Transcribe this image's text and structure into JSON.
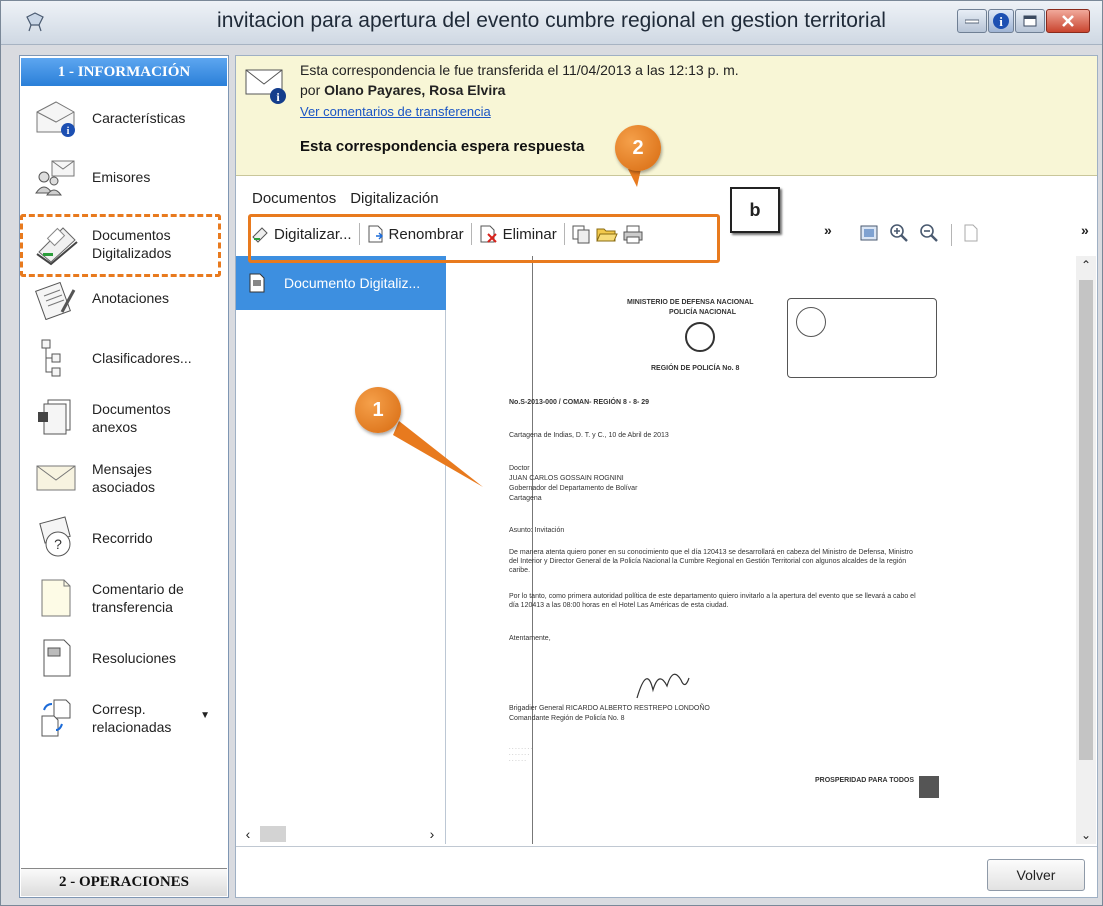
{
  "window": {
    "title": "invitacion para apertura del evento cumbre regional en gestion territorial"
  },
  "sidebar": {
    "header_top": "1 - INFORMACIÓN",
    "header_bottom": "2 - OPERACIONES",
    "items": [
      {
        "label": "Características",
        "icon": "envelope-info-icon"
      },
      {
        "label": "Emisores",
        "icon": "senders-icon"
      },
      {
        "label": "Documentos Digitalizados",
        "icon": "scanner-icon"
      },
      {
        "label": "Anotaciones",
        "icon": "clipboard-icon"
      },
      {
        "label": "Clasificadores...",
        "icon": "tree-icon"
      },
      {
        "label": "Documentos anexos",
        "icon": "attachments-icon"
      },
      {
        "label": "Mensajes asociados",
        "icon": "envelope-icon"
      },
      {
        "label": "Recorrido",
        "icon": "route-icon"
      },
      {
        "label": "Comentario de transferencia",
        "icon": "note-icon"
      },
      {
        "label": "Resoluciones",
        "icon": "resolution-icon"
      },
      {
        "label": "Corresp. relacionadas",
        "icon": "related-icon"
      }
    ]
  },
  "notice": {
    "line1": "Esta correspondencia le fue transferida el 11/04/2013 a las 12:13 p. m.",
    "by_prefix": "por ",
    "by_name": "Olano Payares, Rosa Elvira",
    "link": "Ver comentarios de transferencia",
    "await": "Esta correspondencia espera respuesta"
  },
  "menu": {
    "documentos": "Documentos",
    "digitalizacion": "Digitalización"
  },
  "toolbar": {
    "digitalizar": "Digitalizar...",
    "renombrar": "Renombrar",
    "eliminar": "Eliminar",
    "overflow": "»"
  },
  "document_list": {
    "items": [
      "Documento Digitaliz..."
    ]
  },
  "scan": {
    "header1": "MINISTERIO DE DEFENSA NACIONAL",
    "header2": "POLICÍA NACIONAL",
    "header3": "REGIÓN DE POLICÍA No. 8",
    "ref": "No.S-2013-000        / COMAN- REGIÓN 8 - 8- 29",
    "city": "Cartagena de Indias, D. T. y C., 10 de Abril de 2013",
    "doctor": "Doctor",
    "name": "JUAN CARLOS GOSSAIN ROGNINI",
    "role": "Gobernador del Departamento de Bolívar",
    "place": "Cartagena",
    "subject": "Asunto: Invitación",
    "p1": "De manera atenta quiero poner en su conocimiento que el día 120413 se desarrollará en cabeza del Ministro de Defensa, Ministro del Interior y Director General de la Policía Nacional la Cumbre Regional en Gestión Territorial con algunos alcaldes de la región caribe.",
    "p2": "Por lo tanto, como primera autoridad política de este departamento quiero invitarlo a la apertura del evento que se llevará a cabo el día 120413 a las 08:00 horas en el Hotel Las Américas de esta ciudad.",
    "closing": "Atentamente,",
    "signer": "Brigadier General RICARDO ALBERTO RESTREPO LONDOÑO",
    "signer_role": "Comandante Región de Policía No. 8",
    "footer": "PROSPERIDAD PARA TODOS"
  },
  "footer": {
    "volver": "Volver"
  },
  "annotations": {
    "callout_1": "1",
    "callout_2": "2",
    "callout_b": "b",
    "accent": "#e87a1e"
  }
}
